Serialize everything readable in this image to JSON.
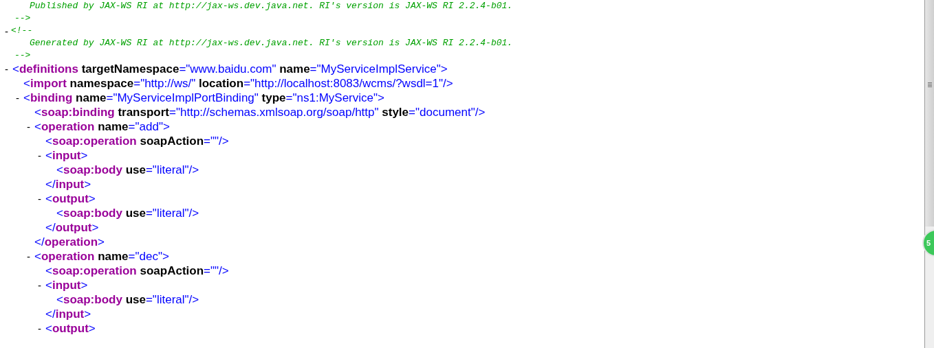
{
  "nodes": [
    {
      "kind": "comment",
      "text": "Published by JAX-WS RI at http://jax-ws.dev.java.net. RI's version is JAX-WS RI 2.2.4-b01.",
      "close": "-->"
    },
    {
      "kind": "comment",
      "toggle": "-",
      "expanded": true,
      "open": "<!--",
      "text": "Generated by JAX-WS RI at http://jax-ws.dev.java.net. RI's version is JAX-WS RI 2.2.4-b01.",
      "close": "-->"
    },
    {
      "kind": "element",
      "toggle": "-",
      "expanded": true,
      "start": "<",
      "tag": "definitions",
      "attrs": [
        {
          "name": "targetNamespace",
          "eq": "=",
          "value": "\"www.baidu.com\""
        },
        {
          "name": "name",
          "eq": "=",
          "value": "\"MyServiceImplService\""
        }
      ],
      "end": ">",
      "children": [
        {
          "kind": "element",
          "start": "<",
          "tag": "import",
          "attrs": [
            {
              "name": "namespace",
              "eq": "=",
              "value": "\"http://ws/\""
            },
            {
              "name": "location",
              "eq": "=",
              "value": "\"http://localhost:8083/wcms/?wsdl=1\""
            }
          ],
          "end": "/>"
        },
        {
          "kind": "element",
          "toggle": "-",
          "expanded": true,
          "start": "<",
          "tag": "binding",
          "attrs": [
            {
              "name": "name",
              "eq": "=",
              "value": "\"MyServiceImplPortBinding\""
            },
            {
              "name": "type",
              "eq": "=",
              "value": "\"ns1:MyService\""
            }
          ],
          "end": ">",
          "children": [
            {
              "kind": "element",
              "start": "<",
              "tag": "soap:binding",
              "attrs": [
                {
                  "name": "transport",
                  "eq": "=",
                  "value": "\"http://schemas.xmlsoap.org/soap/http\""
                },
                {
                  "name": "style",
                  "eq": "=",
                  "value": "\"document\""
                }
              ],
              "end": "/>"
            },
            {
              "kind": "element",
              "toggle": "-",
              "expanded": true,
              "start": "<",
              "tag": "operation",
              "attrs": [
                {
                  "name": "name",
                  "eq": "=",
                  "value": "\"add\""
                }
              ],
              "end": ">",
              "children": [
                {
                  "kind": "element",
                  "start": "<",
                  "tag": "soap:operation",
                  "attrs": [
                    {
                      "name": "soapAction",
                      "eq": "=",
                      "value": "\"\""
                    }
                  ],
                  "end": "/>"
                },
                {
                  "kind": "element",
                  "toggle": "-",
                  "expanded": true,
                  "start": "<",
                  "tag": "input",
                  "end": ">",
                  "children": [
                    {
                      "kind": "element",
                      "start": "<",
                      "tag": "soap:body",
                      "attrs": [
                        {
                          "name": "use",
                          "eq": "=",
                          "value": "\"literal\""
                        }
                      ],
                      "end": "/>"
                    }
                  ],
                  "close": {
                    "start": "</",
                    "tag": "input",
                    "end": ">"
                  }
                },
                {
                  "kind": "element",
                  "toggle": "-",
                  "expanded": true,
                  "start": "<",
                  "tag": "output",
                  "end": ">",
                  "children": [
                    {
                      "kind": "element",
                      "start": "<",
                      "tag": "soap:body",
                      "attrs": [
                        {
                          "name": "use",
                          "eq": "=",
                          "value": "\"literal\""
                        }
                      ],
                      "end": "/>"
                    }
                  ],
                  "close": {
                    "start": "</",
                    "tag": "output",
                    "end": ">"
                  }
                }
              ],
              "close": {
                "start": "</",
                "tag": "operation",
                "end": ">"
              }
            },
            {
              "kind": "element",
              "toggle": "-",
              "expanded": true,
              "start": "<",
              "tag": "operation",
              "attrs": [
                {
                  "name": "name",
                  "eq": "=",
                  "value": "\"dec\""
                }
              ],
              "end": ">",
              "children": [
                {
                  "kind": "element",
                  "start": "<",
                  "tag": "soap:operation",
                  "attrs": [
                    {
                      "name": "soapAction",
                      "eq": "=",
                      "value": "\"\""
                    }
                  ],
                  "end": "/>"
                },
                {
                  "kind": "element",
                  "toggle": "-",
                  "expanded": true,
                  "start": "<",
                  "tag": "input",
                  "end": ">",
                  "children": [
                    {
                      "kind": "element",
                      "start": "<",
                      "tag": "soap:body",
                      "attrs": [
                        {
                          "name": "use",
                          "eq": "=",
                          "value": "\"literal\""
                        }
                      ],
                      "end": "/>"
                    }
                  ],
                  "close": {
                    "start": "</",
                    "tag": "input",
                    "end": ">"
                  }
                },
                {
                  "kind": "element",
                  "toggle": "-",
                  "expanded": true,
                  "start": "<",
                  "tag": "output",
                  "end": ">"
                }
              ]
            }
          ]
        }
      ]
    }
  ],
  "badge": {
    "text": "5"
  }
}
